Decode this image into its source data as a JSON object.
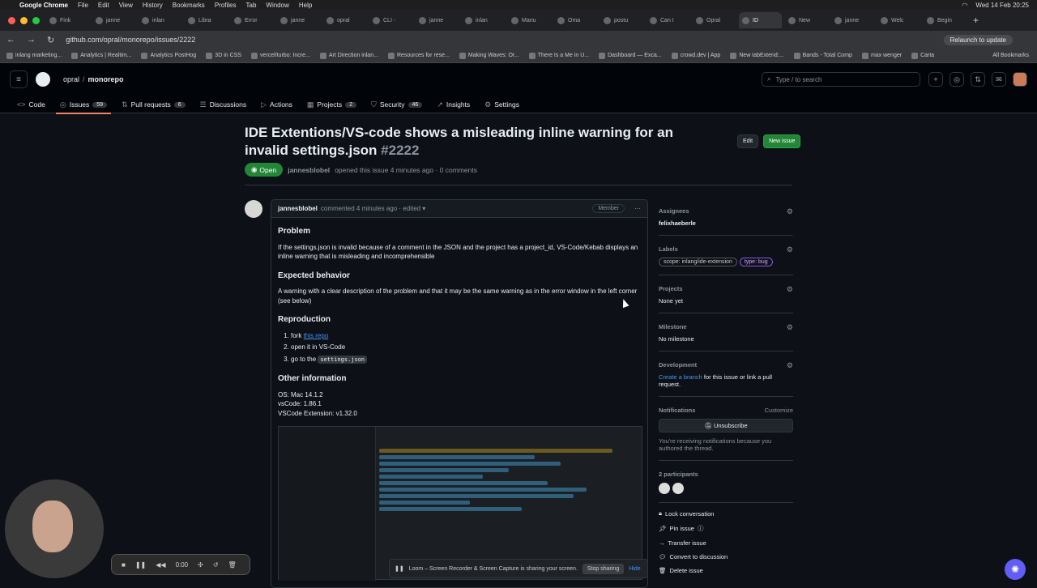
{
  "mac": {
    "app": "Google Chrome",
    "menus": [
      "File",
      "Edit",
      "View",
      "History",
      "Bookmarks",
      "Profiles",
      "Tab",
      "Window",
      "Help"
    ],
    "clock": "Wed 14 Feb 20:25"
  },
  "tabs": [
    "Fink",
    "janne",
    "inlan",
    "Libra",
    "Error",
    "janne",
    "opral",
    "CLI -",
    "janne",
    "inlan",
    "Manu",
    "Oma",
    "postu",
    "Can I",
    "Opral",
    "ID",
    "New",
    "janne",
    "Welc",
    "Begin"
  ],
  "address": {
    "url": "github.com/opral/monorepo/issues/2222",
    "relaunch": "Relaunch to update"
  },
  "bookmarks": [
    "inlang marketing...",
    "Analytics | Realtim...",
    "Analytics PostHog",
    "3D in CSS",
    "vercel/turbo: Incre...",
    "Art Direction inlan...",
    "Resources for rese...",
    "Making Waves: Or...",
    "There Is a Me in U...",
    "Dashboard — Exca...",
    "crowd.dev | App",
    "New tabExtend:...",
    "Bands - Total Comp",
    "max wenger",
    "Carta"
  ],
  "all_bookmarks": "All Bookmarks",
  "header": {
    "owner": "opral",
    "repo": "monorepo",
    "search_placeholder": "Type / to search"
  },
  "repo_nav": [
    {
      "label": "Code",
      "icon": "<>",
      "count": ""
    },
    {
      "label": "Issues",
      "icon": "◎",
      "count": "59"
    },
    {
      "label": "Pull requests",
      "icon": "⇅",
      "count": "6"
    },
    {
      "label": "Discussions",
      "icon": "☰",
      "count": ""
    },
    {
      "label": "Actions",
      "icon": "▷",
      "count": ""
    },
    {
      "label": "Projects",
      "icon": "▦",
      "count": "2"
    },
    {
      "label": "Security",
      "icon": "⛉",
      "count": "46"
    },
    {
      "label": "Insights",
      "icon": "↗",
      "count": ""
    },
    {
      "label": "Settings",
      "icon": "⚙",
      "count": ""
    }
  ],
  "issue": {
    "title": "IDE Extentions/VS-code shows a misleading inline warning for an invalid settings.json",
    "number": "#2222",
    "status": "Open",
    "author": "jannesblobel",
    "meta": "opened this issue 4 minutes ago · 0 comments",
    "edit_label": "Edit",
    "new_issue_label": "New issue"
  },
  "comment": {
    "author": "jannesblobel",
    "meta": "commented 4 minutes ago · edited ▾",
    "badge": "Member",
    "h_problem": "Problem",
    "problem": "If the settings.json is invalid because of a comment in the JSON and the project has a project_id, VS-Code/Kebab displays an inline warning that is misleading and incomprehensible",
    "h_expected": "Expected behavior",
    "expected": "A warning with a clear description of the problem and that it may be the same warning as in the error window in the left corner (see below)",
    "h_repro": "Reproduction",
    "repro1_pre": "fork ",
    "repro1_link": "this repo",
    "repro2": "open it in VS-Code",
    "repro3_pre": "go to the ",
    "repro3_code": "settings.json",
    "h_other": "Other information",
    "os": "OS: Mac 14.1.2",
    "vscode": "vsCode: 1.86.1",
    "ext": "VSCode Extension: v1.32.0"
  },
  "sidebar": {
    "assignees_h": "Assignees",
    "assignee": "felixhaeberle",
    "labels_h": "Labels",
    "label1": "scope: inlang/ide-extension",
    "label2": "type: bug",
    "projects_h": "Projects",
    "projects": "None yet",
    "milestone_h": "Milestone",
    "milestone": "No milestone",
    "dev_h": "Development",
    "dev_link": "Create a branch",
    "dev_rest": " for this issue or link a pull request.",
    "notif_h": "Notifications",
    "customize": "Customize",
    "unsubscribe": "Unsubscribe",
    "notif_text": "You're receiving notifications because you authored the thread.",
    "participants": "2 participants",
    "lock": "Lock conversation",
    "pin": "Pin issue",
    "transfer": "Transfer issue",
    "convert": "Convert to discussion",
    "delete": "Delete issue"
  },
  "loom": {
    "time": "0:00",
    "sharing": "Loom – Screen Recorder & Screen Capture is sharing your screen.",
    "stop": "Stop sharing",
    "hide": "Hide"
  }
}
